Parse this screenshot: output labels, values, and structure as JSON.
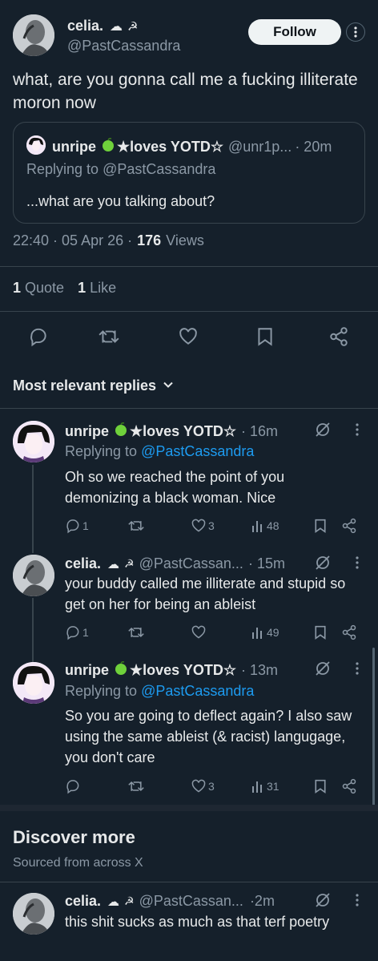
{
  "main_post": {
    "display_name": "celia.",
    "handle": "@PastCassandra",
    "follow_label": "Follow",
    "text": "what, are you gonna call me a fucking illiterate moron now",
    "quote": {
      "name": "unripe",
      "name_suffix": "★loves YOTD☆",
      "handle": "@unr1p...",
      "time": "· 20m",
      "replying_prefix": "Replying to",
      "replying_handle": "@PastCassandra",
      "text": "...what are you talking about?"
    },
    "timestamp": "22:40 · 05 Apr 26 ·",
    "views_count": "176",
    "views_label": "Views",
    "quotes_count": "1",
    "quotes_label": "Quote",
    "likes_count": "1",
    "likes_label": "Like"
  },
  "replies_header": "Most relevant replies",
  "replies": [
    {
      "name": "unripe",
      "name_suffix": "★loves YOTD☆",
      "time": "· 16m",
      "replying_prefix": "Replying to",
      "replying_handle": "@PastCassandra",
      "text": "Oh so we reached the point of you demonizing a black woman. Nice",
      "reply_count": "1",
      "retweet_count": "",
      "like_count": "3",
      "view_count": "48"
    },
    {
      "name": "celia.",
      "handle": "@PastCassan...",
      "time": "· 15m",
      "text": "your buddy called me illiterate and stupid so get on her for being an ableist",
      "reply_count": "1",
      "retweet_count": "",
      "like_count": "",
      "view_count": "49"
    },
    {
      "name": "unripe",
      "name_suffix": "★loves YOTD☆",
      "time": "· 13m",
      "replying_prefix": "Replying to",
      "replying_handle": "@PastCassandra",
      "text": "So you are going to deflect again? I also saw using the same ableist (& racist) langugage, you don't care",
      "reply_count": "",
      "retweet_count": "",
      "like_count": "3",
      "view_count": "31"
    }
  ],
  "discover": {
    "title": "Discover more",
    "subtitle": "Sourced from across X",
    "post": {
      "name": "celia.",
      "handle": "@PastCassan...",
      "time": "·2m",
      "text": "this shit sucks as much as that terf poetry"
    }
  },
  "colors": {
    "background": "#15202b",
    "text": "#e7e9ea",
    "muted": "#8b98a5",
    "link": "#1d9bf0",
    "green_apple": "#6fd13b"
  }
}
